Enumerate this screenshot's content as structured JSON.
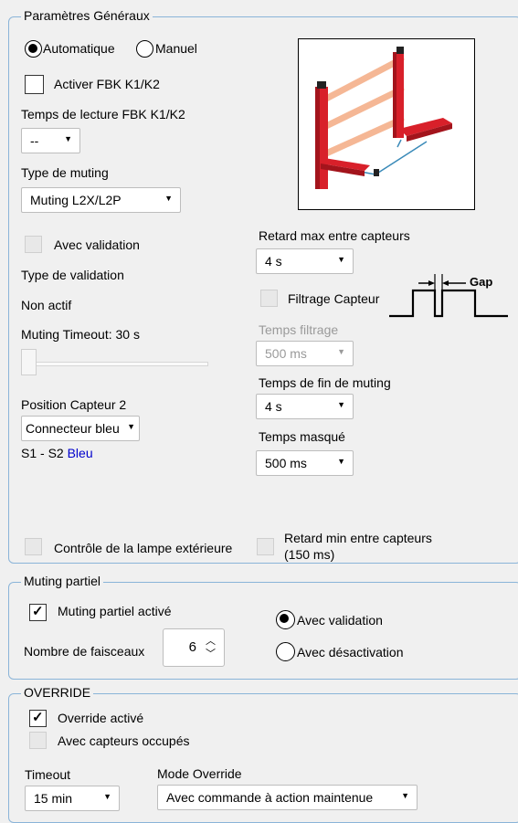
{
  "general": {
    "legend": "Paramètres Généraux",
    "radio_auto": "Automatique",
    "radio_manual": "Manuel",
    "fbk_label": "Activer FBK K1/K2",
    "fbk_time_label": "Temps de lecture FBK K1/K2",
    "fbk_time_value": "--",
    "muting_type_label": "Type de muting",
    "muting_type_value": "Muting L2X/L2P",
    "validation_label": "Avec validation",
    "validation_type_label": "Type de validation",
    "validation_type_value": "Non actif",
    "timeout_label": "Muting Timeout: 30 s",
    "timeout_slider_value": 0,
    "sensor2_label": "Position Capteur 2",
    "sensor2_value": "Connecteur bleu",
    "sensor2_info_prefix": "S1 - S2",
    "sensor2_info_color": "Bleu",
    "max_delay_label": "Retard max entre capteurs",
    "max_delay_value": "4 s",
    "filter_label": "Filtrage Capteur",
    "gap_label": "Gap",
    "filter_time_label": "Temps filtrage",
    "filter_time_value": "500 ms",
    "end_time_label": "Temps de fin de muting",
    "end_time_value": "4 s",
    "mask_time_label": "Temps masqué",
    "mask_time_value": "500 ms",
    "lamp_label": "Contrôle de la lampe extérieure",
    "min_delay_line1": "Retard min entre capteurs",
    "min_delay_line2": "(150 ms)"
  },
  "partial": {
    "legend": "Muting partiel",
    "enabled_label": "Muting partiel activé",
    "beams_label": "Nombre de faisceaux",
    "beams_value": "6",
    "radio_validation": "Avec validation",
    "radio_deactivation": "Avec désactivation"
  },
  "override": {
    "legend": "OVERRIDE",
    "enabled_label": "Override activé",
    "occupied_label": "Avec capteurs occupés",
    "timeout_label": "Timeout",
    "timeout_value": "15 min",
    "mode_label": "Mode Override",
    "mode_value": "Avec commande à action maintenue"
  },
  "colors": {
    "group_border": "#8ab4d8",
    "sensor_red": "#d8202a",
    "beam": "#f4b08a",
    "info_blue": "#0000cc"
  }
}
